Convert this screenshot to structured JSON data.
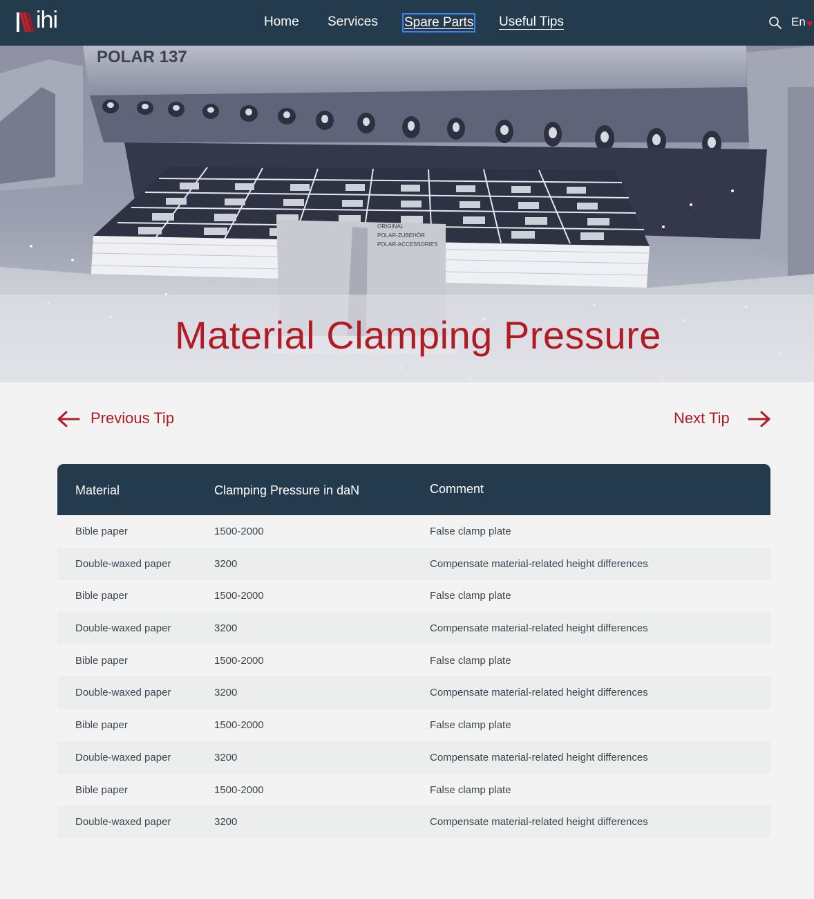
{
  "header": {
    "logo_text": "ihi",
    "nav": [
      {
        "label": "Home"
      },
      {
        "label": "Services"
      },
      {
        "label": "Spare Parts"
      },
      {
        "label": "Useful Tips"
      }
    ],
    "language": "En",
    "colors": {
      "bar": "#243b4e",
      "accent": "#c8202a"
    }
  },
  "hero": {
    "machine_label": "POLAR 137",
    "plate_lines": [
      "ORIGINAL",
      "POLAR-ZUBEHÖR",
      "POLAR-ACCESSORIES"
    ],
    "title": "Material Clamping Pressure"
  },
  "tip_nav": {
    "previous": "Previous Tip",
    "next": "Next Tip"
  },
  "table": {
    "headers": [
      "Material",
      "Clamping Pressure in daN",
      "Comment"
    ],
    "rows": [
      [
        "Bible paper",
        "1500-2000",
        "False clamp plate"
      ],
      [
        "Double-waxed paper",
        "3200",
        "Compensate material-related height differences"
      ],
      [
        "Bible paper",
        "1500-2000",
        "False clamp plate"
      ],
      [
        "Double-waxed paper",
        "3200",
        "Compensate material-related height differences"
      ],
      [
        "Bible paper",
        "1500-2000",
        "False clamp plate"
      ],
      [
        "Double-waxed paper",
        "3200",
        "Compensate material-related height differences"
      ],
      [
        "Bible paper",
        "1500-2000",
        "False clamp plate"
      ],
      [
        "Double-waxed paper",
        "3200",
        "Compensate material-related height differences"
      ],
      [
        "Bible paper",
        "1500-2000",
        "False clamp plate"
      ],
      [
        "Double-waxed paper",
        "3200",
        "Compensate material-related height differences"
      ]
    ]
  }
}
